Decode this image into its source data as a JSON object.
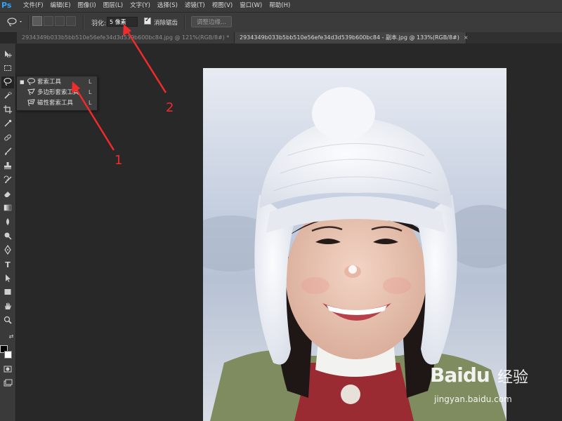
{
  "app": {
    "logo": "Ps"
  },
  "menu": [
    "文件(F)",
    "编辑(E)",
    "图像(I)",
    "图层(L)",
    "文字(Y)",
    "选择(S)",
    "滤镜(T)",
    "视图(V)",
    "窗口(W)",
    "帮助(H)"
  ],
  "options": {
    "feather_label": "羽化:",
    "feather_value": "5 像素",
    "antialias_label": "消除锯齿",
    "antialias_checked": true,
    "refine_edge_label": "调整边缘..."
  },
  "tabs": [
    {
      "label": "2934349b033b5bb510e56efe34d3d539b600bc84.jpg @ 121%(RGB/8#) *",
      "active": false
    },
    {
      "label": "2934349b033b5bb510e56efe34d3d539b600bc84 - 副本.jpg @ 133%(RGB/8#)",
      "active": true,
      "close": "×"
    }
  ],
  "toolbar_icons": [
    "move-icon",
    "marquee-icon",
    "lasso-icon",
    "quick-select-icon",
    "crop-icon",
    "eyedropper-icon",
    "healing-icon",
    "brush-icon",
    "stamp-icon",
    "history-brush-icon",
    "eraser-icon",
    "gradient-icon",
    "blur-icon",
    "dodge-icon",
    "pen-icon",
    "type-icon",
    "path-select-icon",
    "shape-icon",
    "hand-icon",
    "zoom-icon"
  ],
  "flyout": [
    {
      "label": "套索工具",
      "shortcut": "L",
      "selected": true,
      "icon": "lasso-icon"
    },
    {
      "label": "多边形套索工具",
      "shortcut": "L",
      "selected": false,
      "icon": "polygon-lasso-icon"
    },
    {
      "label": "磁性套索工具",
      "shortcut": "L",
      "selected": false,
      "icon": "magnetic-lasso-icon"
    }
  ],
  "annotations": {
    "label_1": "1",
    "label_2": "2",
    "color": "#ef2b2b"
  },
  "watermark": {
    "brand": "Baidu",
    "brand_cn": "经验",
    "url": "jingyan.baidu.com"
  }
}
